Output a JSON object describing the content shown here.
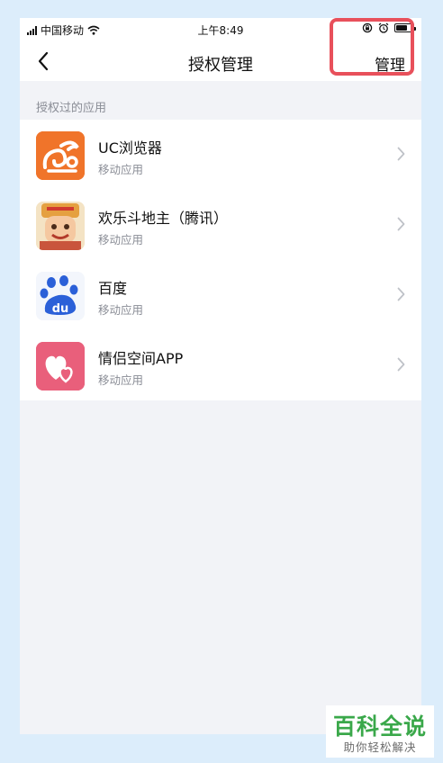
{
  "status_bar": {
    "carrier": "中国移动",
    "time": "上午8:49",
    "battery_level": 0.65
  },
  "nav": {
    "back_icon": "chevron-left-icon",
    "title": "授权管理",
    "manage_label": "管理"
  },
  "section": {
    "header": "授权过的应用"
  },
  "apps": [
    {
      "name": "UC浏览器",
      "type": "移动应用",
      "icon": "uc-browser-icon",
      "color": "#f0742a"
    },
    {
      "name": "欢乐斗地主（腾讯）",
      "type": "移动应用",
      "icon": "doudizhu-icon",
      "color": "#e5a040"
    },
    {
      "name": "百度",
      "type": "移动应用",
      "icon": "baidu-icon",
      "color": "#2b60d8"
    },
    {
      "name": "情侣空间APP",
      "type": "移动应用",
      "icon": "heart-icon",
      "color": "#e95f7b"
    }
  ],
  "watermark": {
    "title": "百科全说",
    "subtitle": "助你轻松解决"
  },
  "colors": {
    "highlight": "#e8505b",
    "watermark_green": "#3aa84a",
    "page_bg": "#dcedfb"
  }
}
